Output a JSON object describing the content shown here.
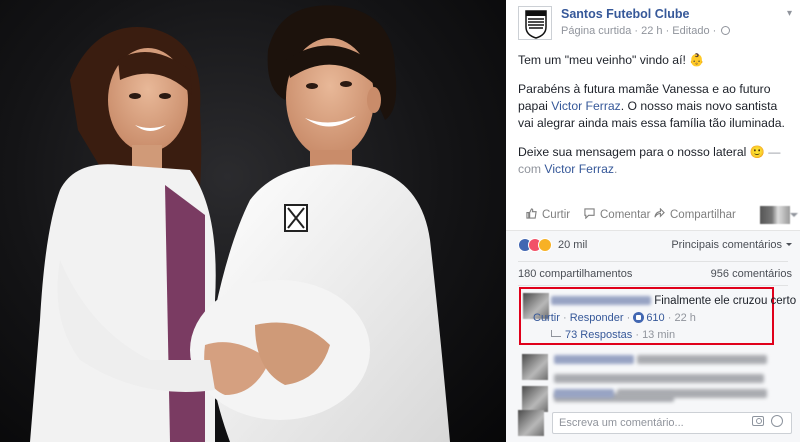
{
  "post": {
    "page_name": "Santos Futebol Clube",
    "meta": "Página curtida · 22 h · Editado ·",
    "text_line1": "Tem um \"meu veinho\" vindo aí! ",
    "p2_before": "Parabéns à futura mamãe Vanessa e ao futuro papai ",
    "p2_link": "Victor Ferraz",
    "p2_after": ". O nosso mais novo santista vai alegrar ainda mais essa família tão iluminada.",
    "p3_text": "Deixe sua mensagem para o nosso lateral ",
    "p3_dash": " —",
    "p3_with": "com ",
    "p3_link": "Victor Ferraz",
    "p3_end": ".",
    "emoji_1": "👶",
    "emoji_2": "🙂"
  },
  "actions": {
    "like": "Curtir",
    "comment": "Comentar",
    "share": "Compartilhar"
  },
  "reactions": {
    "count": "20 mil",
    "sort_label": "Principais comentários"
  },
  "stats": {
    "shares": "180 compartilhamentos",
    "comments": "956 comentários"
  },
  "comment1": {
    "text": "Finalmente ele cruzou certo",
    "like": "Curtir",
    "reply": "Responder",
    "dot": "·",
    "likes": "610",
    "time": "22 h",
    "replies": "73 Respostas",
    "replies_time": "13 min"
  },
  "composer": {
    "placeholder": "Escreva um comentário..."
  },
  "colors": {
    "accent": "#365899",
    "highlight": "#e0001b"
  }
}
